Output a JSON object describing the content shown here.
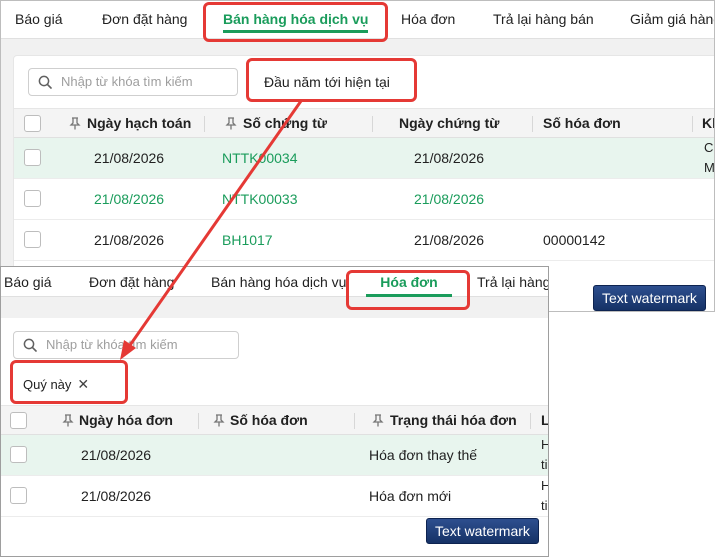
{
  "top_window": {
    "tabs": [
      {
        "label": "Báo giá",
        "active": false
      },
      {
        "label": "Đơn đặt hàng",
        "active": false
      },
      {
        "label": "Bán hàng hóa dịch vụ",
        "active": true
      },
      {
        "label": "Hóa đơn",
        "active": false
      },
      {
        "label": "Trả lại hàng bán",
        "active": false
      },
      {
        "label": "Giảm giá hàng",
        "active": false
      }
    ],
    "search_placeholder": "Nhập từ khóa tìm kiếm",
    "period_filter": "Đầu năm tới hiện tại",
    "columns": [
      "Ngày hạch toán",
      "Số chứng từ",
      "Ngày chứng từ",
      "Số hóa đơn",
      "Kh"
    ],
    "rows": [
      {
        "ngay_hach_toan": "21/08/2026",
        "so_chung_tu": "NTTK00034",
        "ngay_chung_tu": "21/08/2026",
        "so_hoa_don": "",
        "extra": [
          "CÔ",
          "M"
        ],
        "highlighted": true,
        "green_dates": false
      },
      {
        "ngay_hach_toan": "21/08/2026",
        "so_chung_tu": "NTTK00033",
        "ngay_chung_tu": "21/08/2026",
        "so_hoa_don": "",
        "extra": [],
        "highlighted": false,
        "green_dates": true
      },
      {
        "ngay_hach_toan": "21/08/2026",
        "so_chung_tu": "BH1017",
        "ngay_chung_tu": "21/08/2026",
        "so_hoa_don": "00000142",
        "extra": [],
        "highlighted": false,
        "green_dates": false
      }
    ],
    "watermark": "Text watermark"
  },
  "bottom_window": {
    "tabs": [
      {
        "label": "Báo giá",
        "active": false
      },
      {
        "label": "Đơn đặt hàng",
        "active": false
      },
      {
        "label": "Bán hàng hóa dịch vụ",
        "active": false
      },
      {
        "label": "Hóa đơn",
        "active": true
      },
      {
        "label": "Trả lại hàng",
        "active": false
      }
    ],
    "search_placeholder": "Nhập từ khóa tìm kiếm",
    "filter_chip": "Quý này",
    "chip_close": "✕",
    "columns": [
      "Ngày hóa đơn",
      "Số hóa đơn",
      "Trạng thái hóa đơn",
      "L"
    ],
    "rows": [
      {
        "ngay_hoa_don": "21/08/2026",
        "so_hoa_don": "",
        "trang_thai": "Hóa đơn thay thế",
        "extra": [
          "H",
          "ti"
        ],
        "highlighted": true
      },
      {
        "ngay_hoa_don": "21/08/2026",
        "so_hoa_don": "",
        "trang_thai": "Hóa đơn mới",
        "extra": [
          "H",
          "ti"
        ],
        "highlighted": false
      }
    ],
    "watermark": "Text watermark"
  },
  "colors": {
    "accent": "#1a9c5b",
    "callout": "#e53935",
    "row_highlight": "#e8f5ee",
    "watermark_bg": "#1e3c78"
  }
}
